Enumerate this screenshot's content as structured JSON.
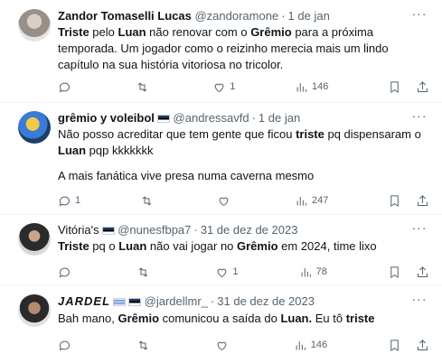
{
  "tweets": [
    {
      "name": "Zandor Tomaselli Lucas",
      "handle": "@zandoramone",
      "date": "1 de jan",
      "text_parts": [
        {
          "t": "Triste",
          "b": true
        },
        {
          "t": " pelo ",
          "b": false
        },
        {
          "t": "Luan",
          "b": true
        },
        {
          "t": " não renovar com o ",
          "b": false
        },
        {
          "t": "Grêmio",
          "b": true
        },
        {
          "t": " para a próxima temporada. Um jogador como o reizinho merecia mais um lindo capítulo na sua história vitoriosa no tricolor.",
          "b": false
        }
      ],
      "replies": "",
      "retweets": "",
      "likes": "1",
      "views": "146"
    },
    {
      "name": "grêmio y voleibol",
      "handle": "@andressavfd",
      "date": "1 de jan",
      "text_parts": [
        {
          "t": "Não posso acreditar que tem gente que ficou ",
          "b": false
        },
        {
          "t": "triste",
          "b": true
        },
        {
          "t": " pq dispensaram o ",
          "b": false
        },
        {
          "t": "Luan",
          "b": true
        },
        {
          "t": " pqp kkkkkkk",
          "b": false
        }
      ],
      "text2": "A mais fanática vive presa numa caverna mesmo",
      "replies": "1",
      "retweets": "",
      "likes": "",
      "views": "247"
    },
    {
      "name": "Vitória's",
      "handle": "@nunesfbpa7",
      "date": "31 de dez de 2023",
      "text_parts": [
        {
          "t": "Triste",
          "b": true
        },
        {
          "t": " pq o ",
          "b": false
        },
        {
          "t": "Luan",
          "b": true
        },
        {
          "t": " não vai jogar no ",
          "b": false
        },
        {
          "t": "Grêmio",
          "b": true
        },
        {
          "t": " em 2024, time lixo",
          "b": false
        }
      ],
      "replies": "",
      "retweets": "",
      "likes": "1",
      "views": "78"
    },
    {
      "name": "JARDEL",
      "handle": "@jardellmr_",
      "date": "31 de dez de 2023",
      "text_parts": [
        {
          "t": "Bah mano, ",
          "b": false
        },
        {
          "t": "Grêmio",
          "b": true
        },
        {
          "t": " comunicou a saída do ",
          "b": false
        },
        {
          "t": "Luan.",
          "b": true
        },
        {
          "t": " Eu tô ",
          "b": false
        },
        {
          "t": "triste",
          "b": true
        }
      ],
      "replies": "",
      "retweets": "",
      "likes": "",
      "views": "146"
    }
  ],
  "icons": {
    "reply": "reply-icon",
    "retweet": "retweet-icon",
    "like": "heart-icon",
    "views": "views-icon",
    "bookmark": "bookmark-icon",
    "share": "share-icon",
    "more": "more-icon"
  },
  "colors": {
    "text": "#0f1419",
    "secondary": "#536471",
    "divider": "#eff3f4"
  }
}
